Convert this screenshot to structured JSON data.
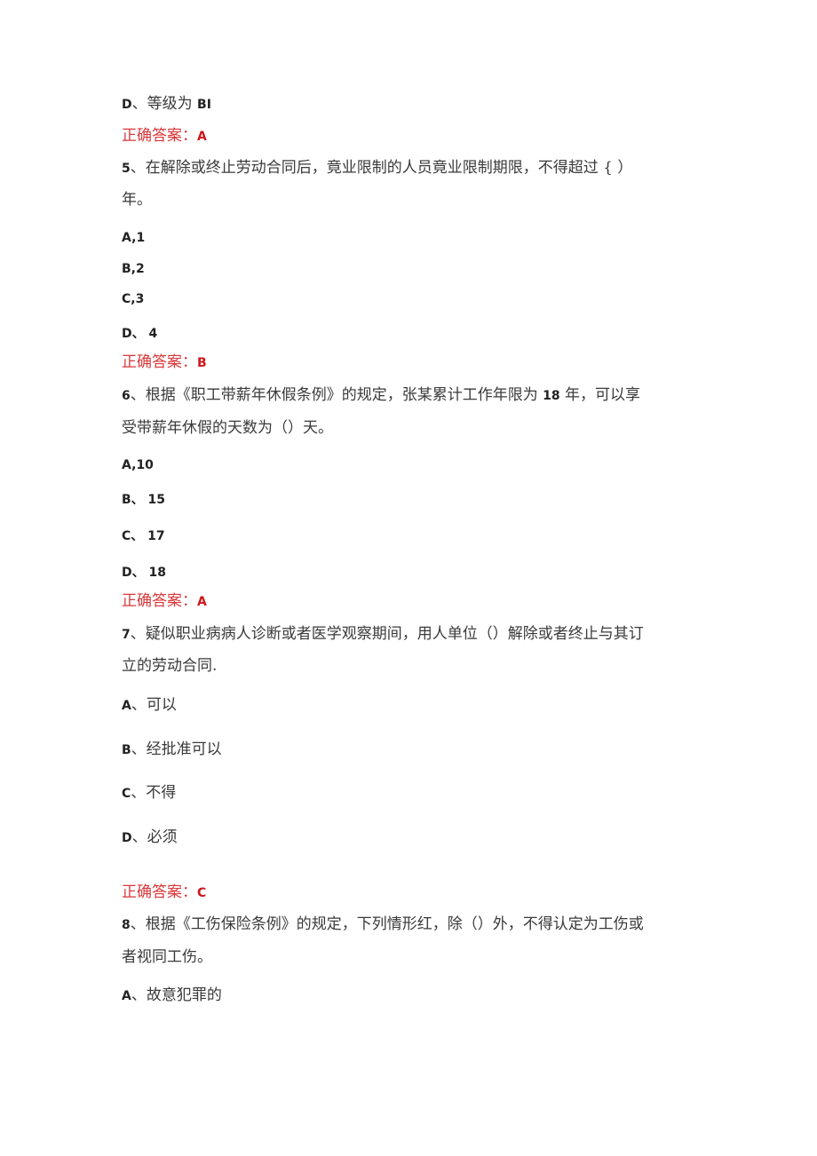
{
  "blocks": [
    {
      "type": "option",
      "letter": "D",
      "sep": "、",
      "text": "等级为 ",
      "bold_suffix": "BI"
    },
    {
      "type": "answer",
      "label": "正确答案：",
      "value": "A"
    },
    {
      "type": "question",
      "number": "5",
      "sep": "、",
      "lines": [
        "在解除或终止劳动合同后，竟业限制的人员竟业限制期限，不得超过 { ）",
        "年。"
      ]
    },
    {
      "type": "option",
      "letter": "A",
      "sep": ",",
      "bold_value": "1"
    },
    {
      "type": "option",
      "letter": "B",
      "sep": ",",
      "bold_value": "2"
    },
    {
      "type": "option",
      "letter": "C",
      "sep": ",",
      "bold_value": "3"
    },
    {
      "type": "option",
      "letter": "D",
      "sep": "、 ",
      "bold_value": "4"
    },
    {
      "type": "answer",
      "label": "正确答案：",
      "value": "B"
    },
    {
      "type": "question",
      "number": "6",
      "sep": "、",
      "lines_parts": [
        [
          "根据《职工带薪年休假条例》的规定，张某累计工作年限为 ",
          "18",
          " 年，可以享"
        ],
        [
          "受带薪年休假的天数为（）天。"
        ]
      ]
    },
    {
      "type": "option",
      "letter": "A",
      "sep": ",",
      "bold_value": "10"
    },
    {
      "type": "option",
      "letter": "B",
      "sep": "、 ",
      "bold_value": "15"
    },
    {
      "type": "option",
      "letter": "C",
      "sep": "、 ",
      "bold_value": "17"
    },
    {
      "type": "option",
      "letter": "D",
      "sep": "、 ",
      "bold_value": "18"
    },
    {
      "type": "answer",
      "label": "正确答案：",
      "value": "A"
    },
    {
      "type": "question",
      "number": "7",
      "sep": "、",
      "lines": [
        "疑似职业病病人诊断或者医学观察期间，用人单位（）解除或者终止与其订",
        "立的劳动合同."
      ]
    },
    {
      "type": "option",
      "letter": "A",
      "sep": "、",
      "text": "可以"
    },
    {
      "type": "option",
      "letter": "B",
      "sep": "、",
      "text": "经批准可以"
    },
    {
      "type": "option",
      "letter": "C",
      "sep": "、",
      "text": "不得"
    },
    {
      "type": "option",
      "letter": "D",
      "sep": "、",
      "text": "必须"
    },
    {
      "type": "answer",
      "label": "正确答案：",
      "value": "C"
    },
    {
      "type": "question",
      "number": "8",
      "sep": "、",
      "lines": [
        "根据《工伤保险条例》的规定，下列情形红，除（）外，不得认定为工伤或",
        "者视同工伤。"
      ]
    },
    {
      "type": "option",
      "letter": "A",
      "sep": "、",
      "text": "故意犯罪的"
    }
  ]
}
